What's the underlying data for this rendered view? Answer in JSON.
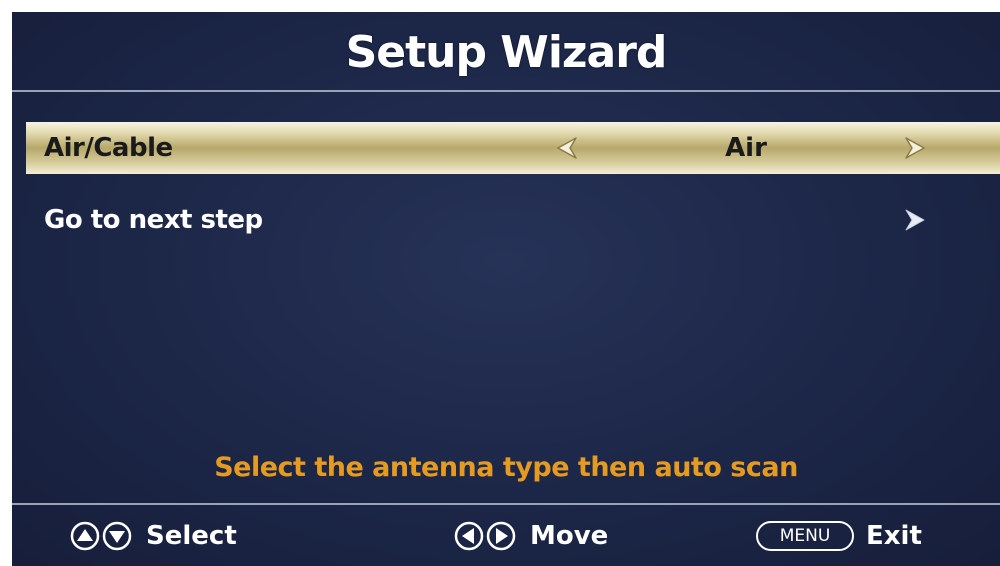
{
  "header": {
    "title": "Setup Wizard"
  },
  "menu": {
    "items": [
      {
        "label": "Air/Cable",
        "value": "Air",
        "selected": true
      },
      {
        "label": "Go to next step",
        "selected": false
      }
    ]
  },
  "hint": {
    "text": "Select the antenna type then auto scan"
  },
  "footer": {
    "select_label": "Select",
    "move_label": "Move",
    "menu_key": "MENU",
    "exit_label": "Exit"
  },
  "colors": {
    "background": "#1c2647",
    "highlight": "#d9cf9f",
    "hint": "#e59a22",
    "text": "#ffffff"
  },
  "icons": {
    "up": "up-arrow-icon",
    "down": "down-arrow-icon",
    "left": "left-arrow-icon",
    "right": "right-arrow-icon",
    "chevron_right": "chevron-right-icon"
  }
}
